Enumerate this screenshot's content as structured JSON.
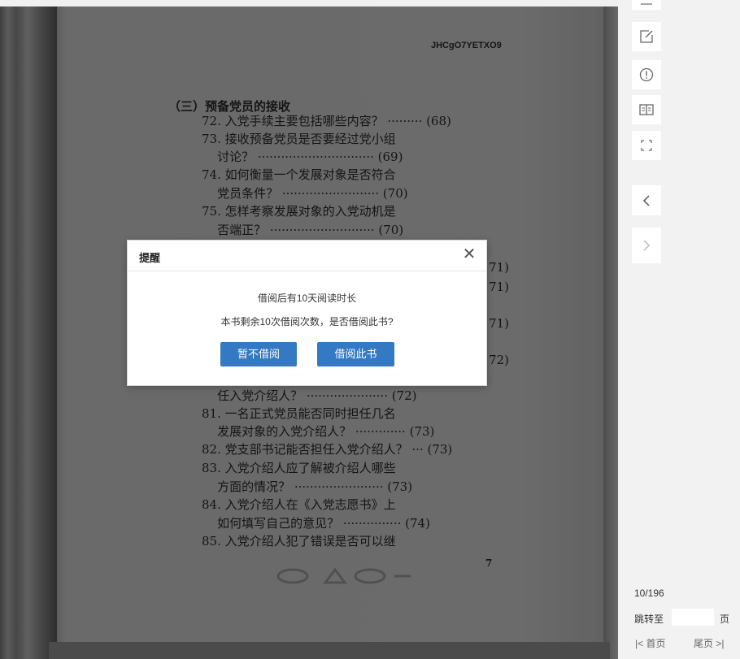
{
  "book": {
    "code": "JHCgO7YETXO9",
    "section_title": "（三）预备党员的接收",
    "lines": [
      "72. 入党手续主要包括哪些内容？ ········· (68)",
      "73. 接收预备党员是否要经过党小组",
      "    讨论？ ······························ (69)",
      "74. 如何衡量一个发展对象是否符合",
      "    党员条件？ ························· (70)",
      "75. 怎样考察发展对象的入党动机是",
      "    否端正？ ··························· (70)",
      "71)",
      "71)",
      "71)",
      "72)",
      "    任入党介绍人？ ····················· (72)",
      "81. 一名正式党员能否同时担任几名",
      "    发展对象的入党介绍人？ ············· (73)",
      "82. 党支部书记能否担任入党介绍人？ ··· (73)",
      "83. 入党介绍人应了解被介绍人哪些",
      "    方面的情况？ ······················· (73)",
      "84. 入党介绍人在《入党志愿书》上",
      "    如何填写自己的意见？ ··············· (74)",
      "85. 入党介绍人犯了错误是否可以继"
    ],
    "page_number": "7"
  },
  "modal": {
    "title": "提醒",
    "close_symbol": "✕",
    "line1": "借阅后有10天阅读时长",
    "line2": "本书剩余10次借阅次数，是否借阅此书?",
    "btn_no": "暂不借阅",
    "btn_yes": "借阅此书"
  },
  "toolbar": {
    "icons": [
      "comment-icon",
      "edit-note-icon",
      "report-icon",
      "book-view-icon",
      "fullscreen-icon",
      "prev-page-icon",
      "next-page-icon"
    ]
  },
  "pager": {
    "count": "10/196",
    "jump_label": "跳转至",
    "jump_suffix": "页",
    "first": "|< 首页",
    "last": "尾页 >|"
  },
  "colors": {
    "button": "#3379c3",
    "page": "#6b6b6b"
  }
}
